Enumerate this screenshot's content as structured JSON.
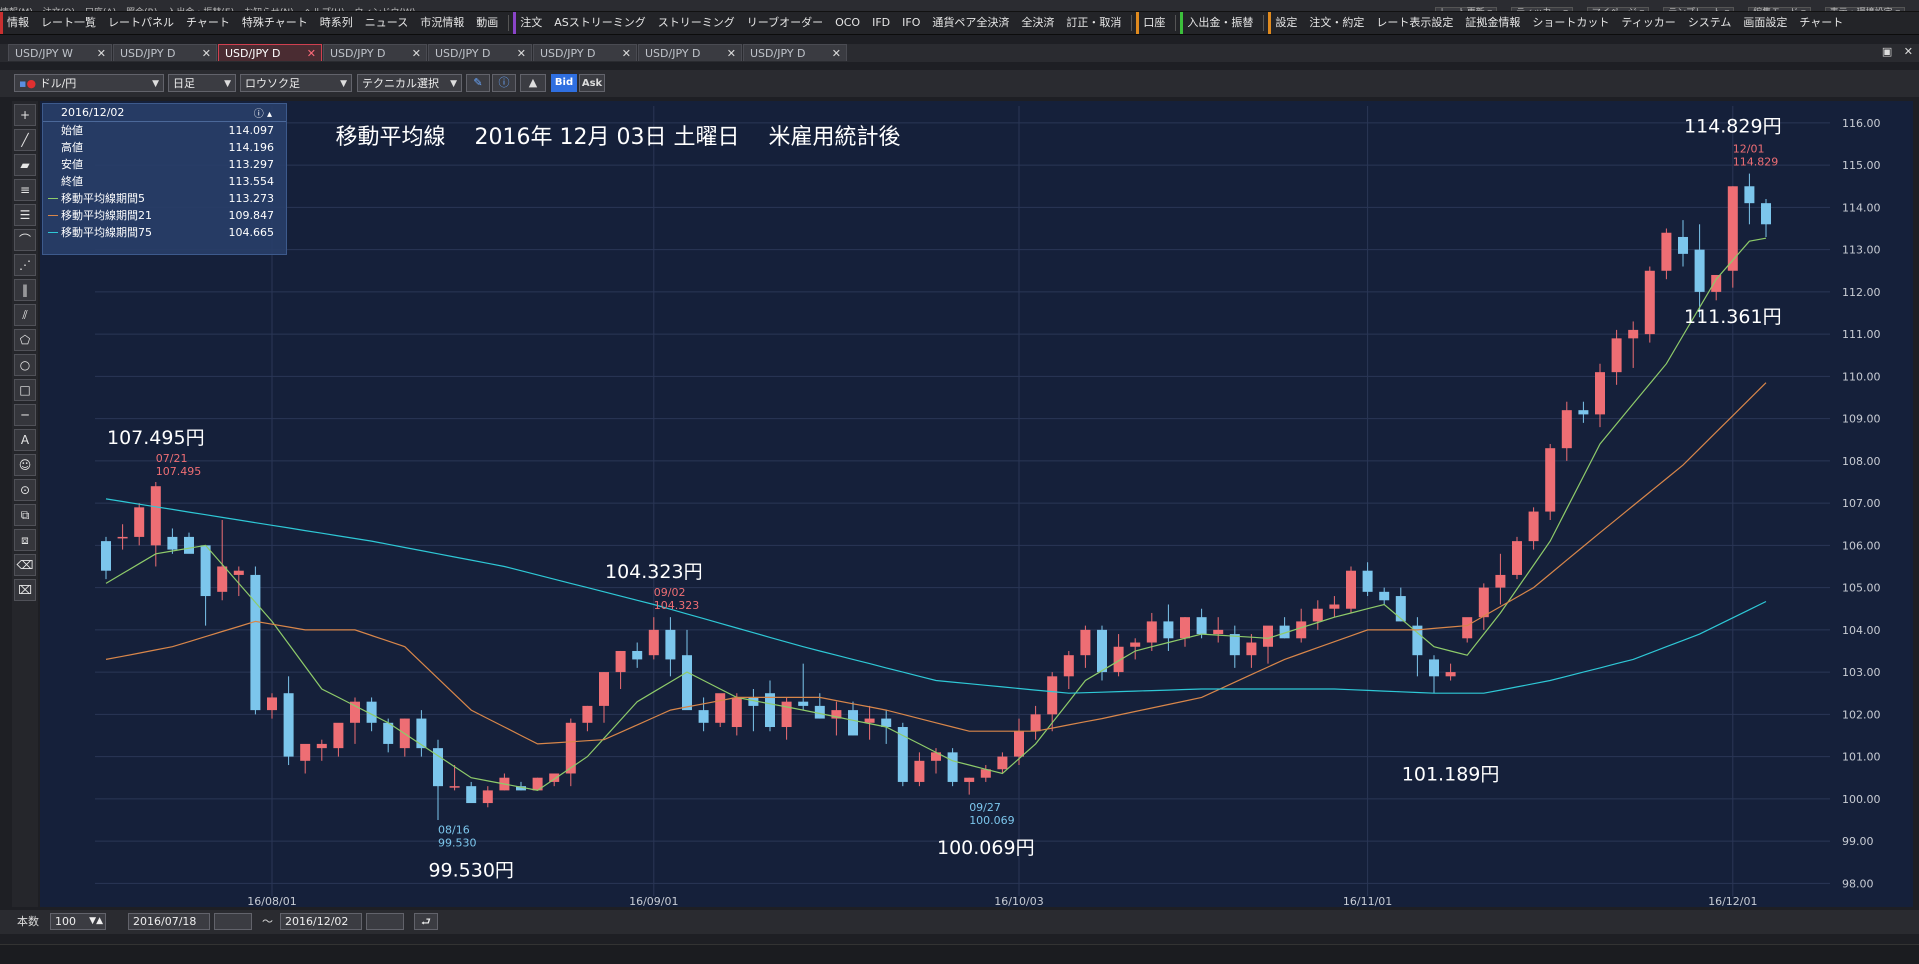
{
  "menubar": {
    "items": [
      "情報(M)",
      "注文(O)",
      "口座(A)",
      "照会(R)",
      "入出金・振替(E)",
      "お知らせ(N)",
      "ヘルプ(H)",
      "ウィンドウ(W)"
    ],
    "right_buttons": [
      "レート更新 ▾",
      "ティッカー ▾",
      "マイページ ▾",
      "テンプレート ▾",
      "編集モード ▾",
      "表示・環境設定 ▾"
    ]
  },
  "toolbar": {
    "items": [
      {
        "label": "情報",
        "marker": "red"
      },
      {
        "label": "レート一覧"
      },
      {
        "label": "レートパネル"
      },
      {
        "label": "チャート"
      },
      {
        "label": "特殊チャート"
      },
      {
        "label": "時系列"
      },
      {
        "label": "ニュース"
      },
      {
        "label": "市況情報"
      },
      {
        "label": "動画"
      },
      {
        "label": "注文",
        "marker": "purple"
      },
      {
        "label": "ASストリーミング"
      },
      {
        "label": "ストリーミング"
      },
      {
        "label": "リーブオーダー"
      },
      {
        "label": "OCO"
      },
      {
        "label": "IFD"
      },
      {
        "label": "IFO"
      },
      {
        "label": "通貨ペア全決済"
      },
      {
        "label": "全決済"
      },
      {
        "label": "訂正・取消"
      },
      {
        "label": "口座",
        "marker": "orange"
      },
      {
        "label": "入出金・振替",
        "marker": "green"
      },
      {
        "label": "設定",
        "marker": "orange"
      },
      {
        "label": "注文・約定"
      },
      {
        "label": "レート表示設定"
      },
      {
        "label": "証拠金情報"
      },
      {
        "label": "ショートカット"
      },
      {
        "label": "ティッカー"
      },
      {
        "label": "システム"
      },
      {
        "label": "画面設定"
      },
      {
        "label": "チャート"
      }
    ]
  },
  "tabs": [
    {
      "label": "USD/JPY W",
      "active": false
    },
    {
      "label": "USD/JPY D",
      "active": false
    },
    {
      "label": "USD/JPY D",
      "active": true
    },
    {
      "label": "USD/JPY D",
      "active": false
    },
    {
      "label": "USD/JPY D",
      "active": false
    },
    {
      "label": "USD/JPY D",
      "active": false
    },
    {
      "label": "USD/JPY D",
      "active": false
    },
    {
      "label": "USD/JPY D",
      "active": false
    }
  ],
  "chart_toolbar": {
    "pair": "ドル/円",
    "period": "日足",
    "chart_style": "ロウソク足",
    "indicator": "テクニカル選択",
    "bid_label": "Bid",
    "ask_label": "Ask"
  },
  "info_panel": {
    "date": "2016/12/02",
    "rows": [
      {
        "label": "始値",
        "value": "114.097"
      },
      {
        "label": "高値",
        "value": "114.196"
      },
      {
        "label": "安値",
        "value": "113.297"
      },
      {
        "label": "終値",
        "value": "113.554"
      },
      {
        "label": "移動平均線期間5",
        "value": "113.273",
        "color": "#8ecb6a"
      },
      {
        "label": "移動平均線期間21",
        "value": "109.847",
        "color": "#d8864a"
      },
      {
        "label": "移動平均線期間75",
        "value": "104.665",
        "color": "#2ec8d6"
      }
    ]
  },
  "bottom_bar": {
    "count_label": "本数",
    "count_value": "100",
    "start_date": "2016/07/18",
    "range_sep": "〜",
    "end_date": "2016/12/02"
  },
  "chart_data": {
    "type": "candlestick",
    "title": "移動平均線　 2016年 12月 03日 土曜日　 米雇用統計後",
    "ylim": [
      97.7,
      116.4
    ],
    "yticks": [
      "116.00",
      "115.00",
      "114.00",
      "113.00",
      "112.00",
      "111.00",
      "110.00",
      "109.00",
      "108.00",
      "107.00",
      "106.00",
      "105.00",
      "104.00",
      "103.00",
      "102.00",
      "101.00",
      "100.00",
      "99.00",
      "98.00"
    ],
    "xticks": [
      {
        "label": "16/08/01",
        "index": 10
      },
      {
        "label": "16/09/01",
        "index": 33
      },
      {
        "label": "16/10/03",
        "index": 55
      },
      {
        "label": "16/11/01",
        "index": 76
      },
      {
        "label": "16/12/01",
        "index": 98
      }
    ],
    "up_color": "#ee6e74",
    "down_color": "#7cc6ec",
    "candles": [
      [
        106.1,
        106.2,
        105.2,
        105.4
      ],
      [
        106.2,
        106.5,
        105.9,
        106.2
      ],
      [
        106.2,
        107.0,
        106.0,
        106.9
      ],
      [
        106.0,
        107.5,
        105.5,
        107.4
      ],
      [
        106.2,
        106.4,
        105.8,
        105.9
      ],
      [
        106.2,
        106.3,
        105.9,
        105.8
      ],
      [
        106.0,
        106.0,
        104.1,
        104.8
      ],
      [
        104.9,
        106.6,
        104.7,
        105.5
      ],
      [
        105.3,
        105.5,
        104.8,
        105.4
      ],
      [
        105.3,
        105.5,
        102.0,
        102.1
      ],
      [
        102.1,
        102.5,
        101.9,
        102.4
      ],
      [
        102.5,
        102.9,
        100.8,
        101.0
      ],
      [
        100.9,
        101.2,
        100.6,
        101.3
      ],
      [
        101.2,
        101.4,
        100.9,
        101.3
      ],
      [
        101.2,
        101.6,
        101.0,
        101.8
      ],
      [
        101.8,
        102.4,
        101.3,
        102.3
      ],
      [
        102.3,
        102.4,
        101.6,
        101.8
      ],
      [
        101.8,
        101.9,
        101.1,
        101.3
      ],
      [
        101.2,
        101.9,
        101.0,
        101.9
      ],
      [
        101.9,
        102.1,
        101.0,
        101.2
      ],
      [
        101.2,
        101.4,
        99.5,
        100.3
      ],
      [
        100.3,
        100.8,
        100.2,
        100.3
      ],
      [
        100.3,
        100.4,
        100.1,
        99.9
      ],
      [
        99.9,
        100.3,
        99.8,
        100.2
      ],
      [
        100.2,
        100.6,
        100.2,
        100.5
      ],
      [
        100.3,
        100.4,
        100.2,
        100.2
      ],
      [
        100.2,
        100.5,
        100.2,
        100.5
      ],
      [
        100.4,
        100.6,
        100.3,
        100.6
      ],
      [
        100.6,
        101.9,
        100.3,
        101.8
      ],
      [
        101.8,
        102.2,
        101.6,
        102.2
      ],
      [
        102.2,
        103.0,
        101.8,
        103.0
      ],
      [
        103.0,
        103.5,
        102.6,
        103.5
      ],
      [
        103.5,
        103.7,
        103.1,
        103.3
      ],
      [
        103.4,
        104.3,
        103.3,
        104.0
      ],
      [
        104.0,
        104.3,
        102.9,
        103.3
      ],
      [
        103.4,
        104.0,
        103.2,
        102.1
      ],
      [
        102.1,
        102.4,
        101.6,
        101.8
      ],
      [
        101.8,
        102.2,
        101.7,
        102.5
      ],
      [
        101.7,
        102.5,
        101.5,
        102.4
      ],
      [
        102.4,
        102.6,
        101.6,
        102.2
      ],
      [
        102.5,
        102.8,
        101.6,
        101.7
      ],
      [
        101.7,
        102.4,
        101.4,
        102.3
      ],
      [
        102.3,
        103.2,
        102.1,
        102.2
      ],
      [
        102.2,
        102.5,
        101.9,
        101.9
      ],
      [
        101.9,
        102.3,
        101.5,
        102.1
      ],
      [
        102.1,
        102.3,
        101.5,
        101.5
      ],
      [
        101.8,
        102.2,
        101.4,
        101.9
      ],
      [
        101.9,
        102.1,
        101.3,
        101.7
      ],
      [
        101.7,
        101.8,
        100.3,
        100.4
      ],
      [
        100.4,
        101.1,
        100.3,
        100.9
      ],
      [
        100.9,
        101.2,
        100.6,
        101.1
      ],
      [
        101.1,
        101.2,
        100.3,
        100.4
      ],
      [
        100.4,
        100.5,
        100.1,
        100.5
      ],
      [
        100.5,
        100.8,
        100.4,
        100.7
      ],
      [
        100.7,
        101.1,
        100.6,
        101.0
      ],
      [
        101.0,
        101.9,
        100.8,
        101.6
      ],
      [
        101.6,
        102.2,
        101.4,
        102.0
      ],
      [
        102.0,
        103.0,
        101.6,
        102.9
      ],
      [
        102.9,
        103.5,
        102.6,
        103.4
      ],
      [
        103.4,
        104.1,
        103.1,
        104.0
      ],
      [
        104.0,
        104.1,
        102.8,
        103.0
      ],
      [
        103.0,
        103.9,
        102.9,
        103.6
      ],
      [
        103.6,
        103.8,
        103.3,
        103.7
      ],
      [
        103.7,
        104.4,
        103.5,
        104.2
      ],
      [
        104.2,
        104.6,
        103.5,
        103.8
      ],
      [
        103.8,
        104.3,
        103.6,
        104.3
      ],
      [
        104.3,
        104.5,
        103.8,
        103.9
      ],
      [
        103.9,
        104.3,
        103.7,
        104.0
      ],
      [
        103.9,
        104.1,
        103.1,
        103.4
      ],
      [
        103.4,
        103.9,
        103.1,
        103.7
      ],
      [
        103.6,
        104.0,
        103.2,
        104.1
      ],
      [
        104.1,
        104.3,
        103.8,
        103.8
      ],
      [
        103.8,
        104.5,
        103.7,
        104.2
      ],
      [
        104.2,
        104.7,
        104.0,
        104.5
      ],
      [
        104.5,
        104.8,
        104.3,
        104.6
      ],
      [
        104.5,
        105.5,
        104.4,
        105.4
      ],
      [
        105.4,
        105.6,
        104.8,
        104.9
      ],
      [
        104.9,
        105.0,
        104.6,
        104.7
      ],
      [
        104.8,
        105.0,
        104.2,
        104.2
      ],
      [
        104.1,
        104.3,
        102.9,
        103.4
      ],
      [
        103.3,
        103.4,
        102.5,
        102.9
      ],
      [
        102.9,
        103.2,
        102.8,
        103.0
      ],
      [
        103.8,
        104.2,
        103.7,
        104.3
      ],
      [
        104.3,
        105.1,
        104.0,
        105.0
      ],
      [
        105.0,
        105.8,
        104.6,
        105.3
      ],
      [
        105.3,
        106.2,
        105.2,
        106.1
      ],
      [
        106.1,
        106.9,
        105.9,
        106.8
      ],
      [
        106.8,
        108.4,
        106.6,
        108.3
      ],
      [
        108.3,
        109.4,
        108.0,
        109.2
      ],
      [
        109.2,
        109.4,
        108.9,
        109.1
      ],
      [
        109.1,
        110.3,
        108.8,
        110.1
      ],
      [
        110.1,
        111.1,
        109.8,
        110.9
      ],
      [
        110.9,
        111.3,
        110.2,
        111.1
      ],
      [
        111.0,
        112.6,
        110.8,
        112.5
      ],
      [
        112.5,
        113.5,
        112.3,
        113.4
      ],
      [
        113.3,
        113.7,
        112.6,
        112.9
      ],
      [
        113.0,
        113.6,
        111.4,
        112.0
      ],
      [
        112.0,
        112.4,
        111.8,
        112.4
      ],
      [
        112.5,
        114.5,
        112.1,
        114.5
      ],
      [
        114.5,
        114.8,
        113.6,
        114.1
      ],
      [
        114.1,
        114.2,
        113.3,
        113.6
      ]
    ],
    "ma_series": [
      {
        "name": "移動平均線期間5",
        "color": "#8ecb6a",
        "keys": [
          [
            0,
            105.1
          ],
          [
            3,
            105.8
          ],
          [
            6,
            106.0
          ],
          [
            10,
            104.2
          ],
          [
            13,
            102.6
          ],
          [
            17,
            101.8
          ],
          [
            22,
            100.5
          ],
          [
            26,
            100.2
          ],
          [
            29,
            101.0
          ],
          [
            32,
            102.3
          ],
          [
            35,
            103.0
          ],
          [
            38,
            102.4
          ],
          [
            42,
            102.1
          ],
          [
            47,
            101.7
          ],
          [
            51,
            100.9
          ],
          [
            54,
            100.6
          ],
          [
            56,
            101.3
          ],
          [
            59,
            102.8
          ],
          [
            62,
            103.5
          ],
          [
            66,
            103.9
          ],
          [
            70,
            103.8
          ],
          [
            74,
            104.3
          ],
          [
            77,
            104.6
          ],
          [
            80,
            103.6
          ],
          [
            82,
            103.4
          ],
          [
            84,
            104.4
          ],
          [
            87,
            106.1
          ],
          [
            90,
            108.4
          ],
          [
            94,
            110.3
          ],
          [
            97,
            112.3
          ],
          [
            99,
            113.2
          ],
          [
            100,
            113.27
          ]
        ]
      },
      {
        "name": "移動平均線期間21",
        "color": "#d8864a",
        "keys": [
          [
            0,
            103.3
          ],
          [
            4,
            103.6
          ],
          [
            9,
            104.2
          ],
          [
            12,
            104.0
          ],
          [
            15,
            104.0
          ],
          [
            18,
            103.6
          ],
          [
            22,
            102.1
          ],
          [
            26,
            101.3
          ],
          [
            30,
            101.4
          ],
          [
            34,
            102.1
          ],
          [
            38,
            102.4
          ],
          [
            43,
            102.4
          ],
          [
            47,
            102.1
          ],
          [
            52,
            101.6
          ],
          [
            56,
            101.6
          ],
          [
            60,
            101.9
          ],
          [
            66,
            102.4
          ],
          [
            71,
            103.3
          ],
          [
            76,
            104.0
          ],
          [
            79,
            104.0
          ],
          [
            82,
            104.1
          ],
          [
            86,
            105.0
          ],
          [
            90,
            106.3
          ],
          [
            95,
            107.9
          ],
          [
            100,
            109.85
          ]
        ]
      },
      {
        "name": "移動平均線期間75",
        "color": "#2ec8d6",
        "keys": [
          [
            0,
            107.1
          ],
          [
            8,
            106.6
          ],
          [
            16,
            106.1
          ],
          [
            24,
            105.5
          ],
          [
            33,
            104.6
          ],
          [
            42,
            103.6
          ],
          [
            50,
            102.8
          ],
          [
            58,
            102.5
          ],
          [
            66,
            102.6
          ],
          [
            74,
            102.6
          ],
          [
            80,
            102.5
          ],
          [
            83,
            102.5
          ],
          [
            87,
            102.8
          ],
          [
            92,
            103.3
          ],
          [
            96,
            103.9
          ],
          [
            100,
            104.67
          ]
        ]
      }
    ],
    "annotations": [
      {
        "text": "107.495円",
        "index": 3,
        "price": 107.495,
        "pos": "big-above"
      },
      {
        "text": "07/21",
        "index": 3,
        "price": 107.495,
        "pos": "small-above-1"
      },
      {
        "text": "107.495",
        "index": 3,
        "price": 107.495,
        "pos": "small-above-2"
      },
      {
        "text": "104.323円",
        "index": 33,
        "price": 104.323,
        "pos": "big-above"
      },
      {
        "text": "09/02",
        "index": 33,
        "price": 104.323,
        "pos": "small-above-1"
      },
      {
        "text": "104.323",
        "index": 33,
        "price": 104.323,
        "pos": "small-above-2"
      },
      {
        "text": "114.829円",
        "index": 98,
        "price": 114.829,
        "pos": "big-above"
      },
      {
        "text": "12/01",
        "index": 98,
        "price": 114.829,
        "pos": "small-above-1"
      },
      {
        "text": "114.829",
        "index": 98,
        "price": 114.829,
        "pos": "small-above-2"
      },
      {
        "text": "08/16",
        "index": 20,
        "price": 99.53,
        "pos": "small-below-1"
      },
      {
        "text": "99.530",
        "index": 20,
        "price": 99.53,
        "pos": "small-below-2"
      },
      {
        "text": "99.530円",
        "index": 22,
        "price": 99.53,
        "pos": "big-below"
      },
      {
        "text": "09/27",
        "index": 52,
        "price": 100.069,
        "pos": "small-below-1"
      },
      {
        "text": "100.069",
        "index": 52,
        "price": 100.069,
        "pos": "small-below-2"
      },
      {
        "text": "100.069円",
        "index": 53,
        "price": 100.069,
        "pos": "big-below"
      },
      {
        "text": "101.189円",
        "index": 81,
        "price": 101.189,
        "pos": "big-below"
      },
      {
        "text": "111.361円",
        "index": 98,
        "price": 111.361,
        "pos": "big-below"
      }
    ]
  }
}
